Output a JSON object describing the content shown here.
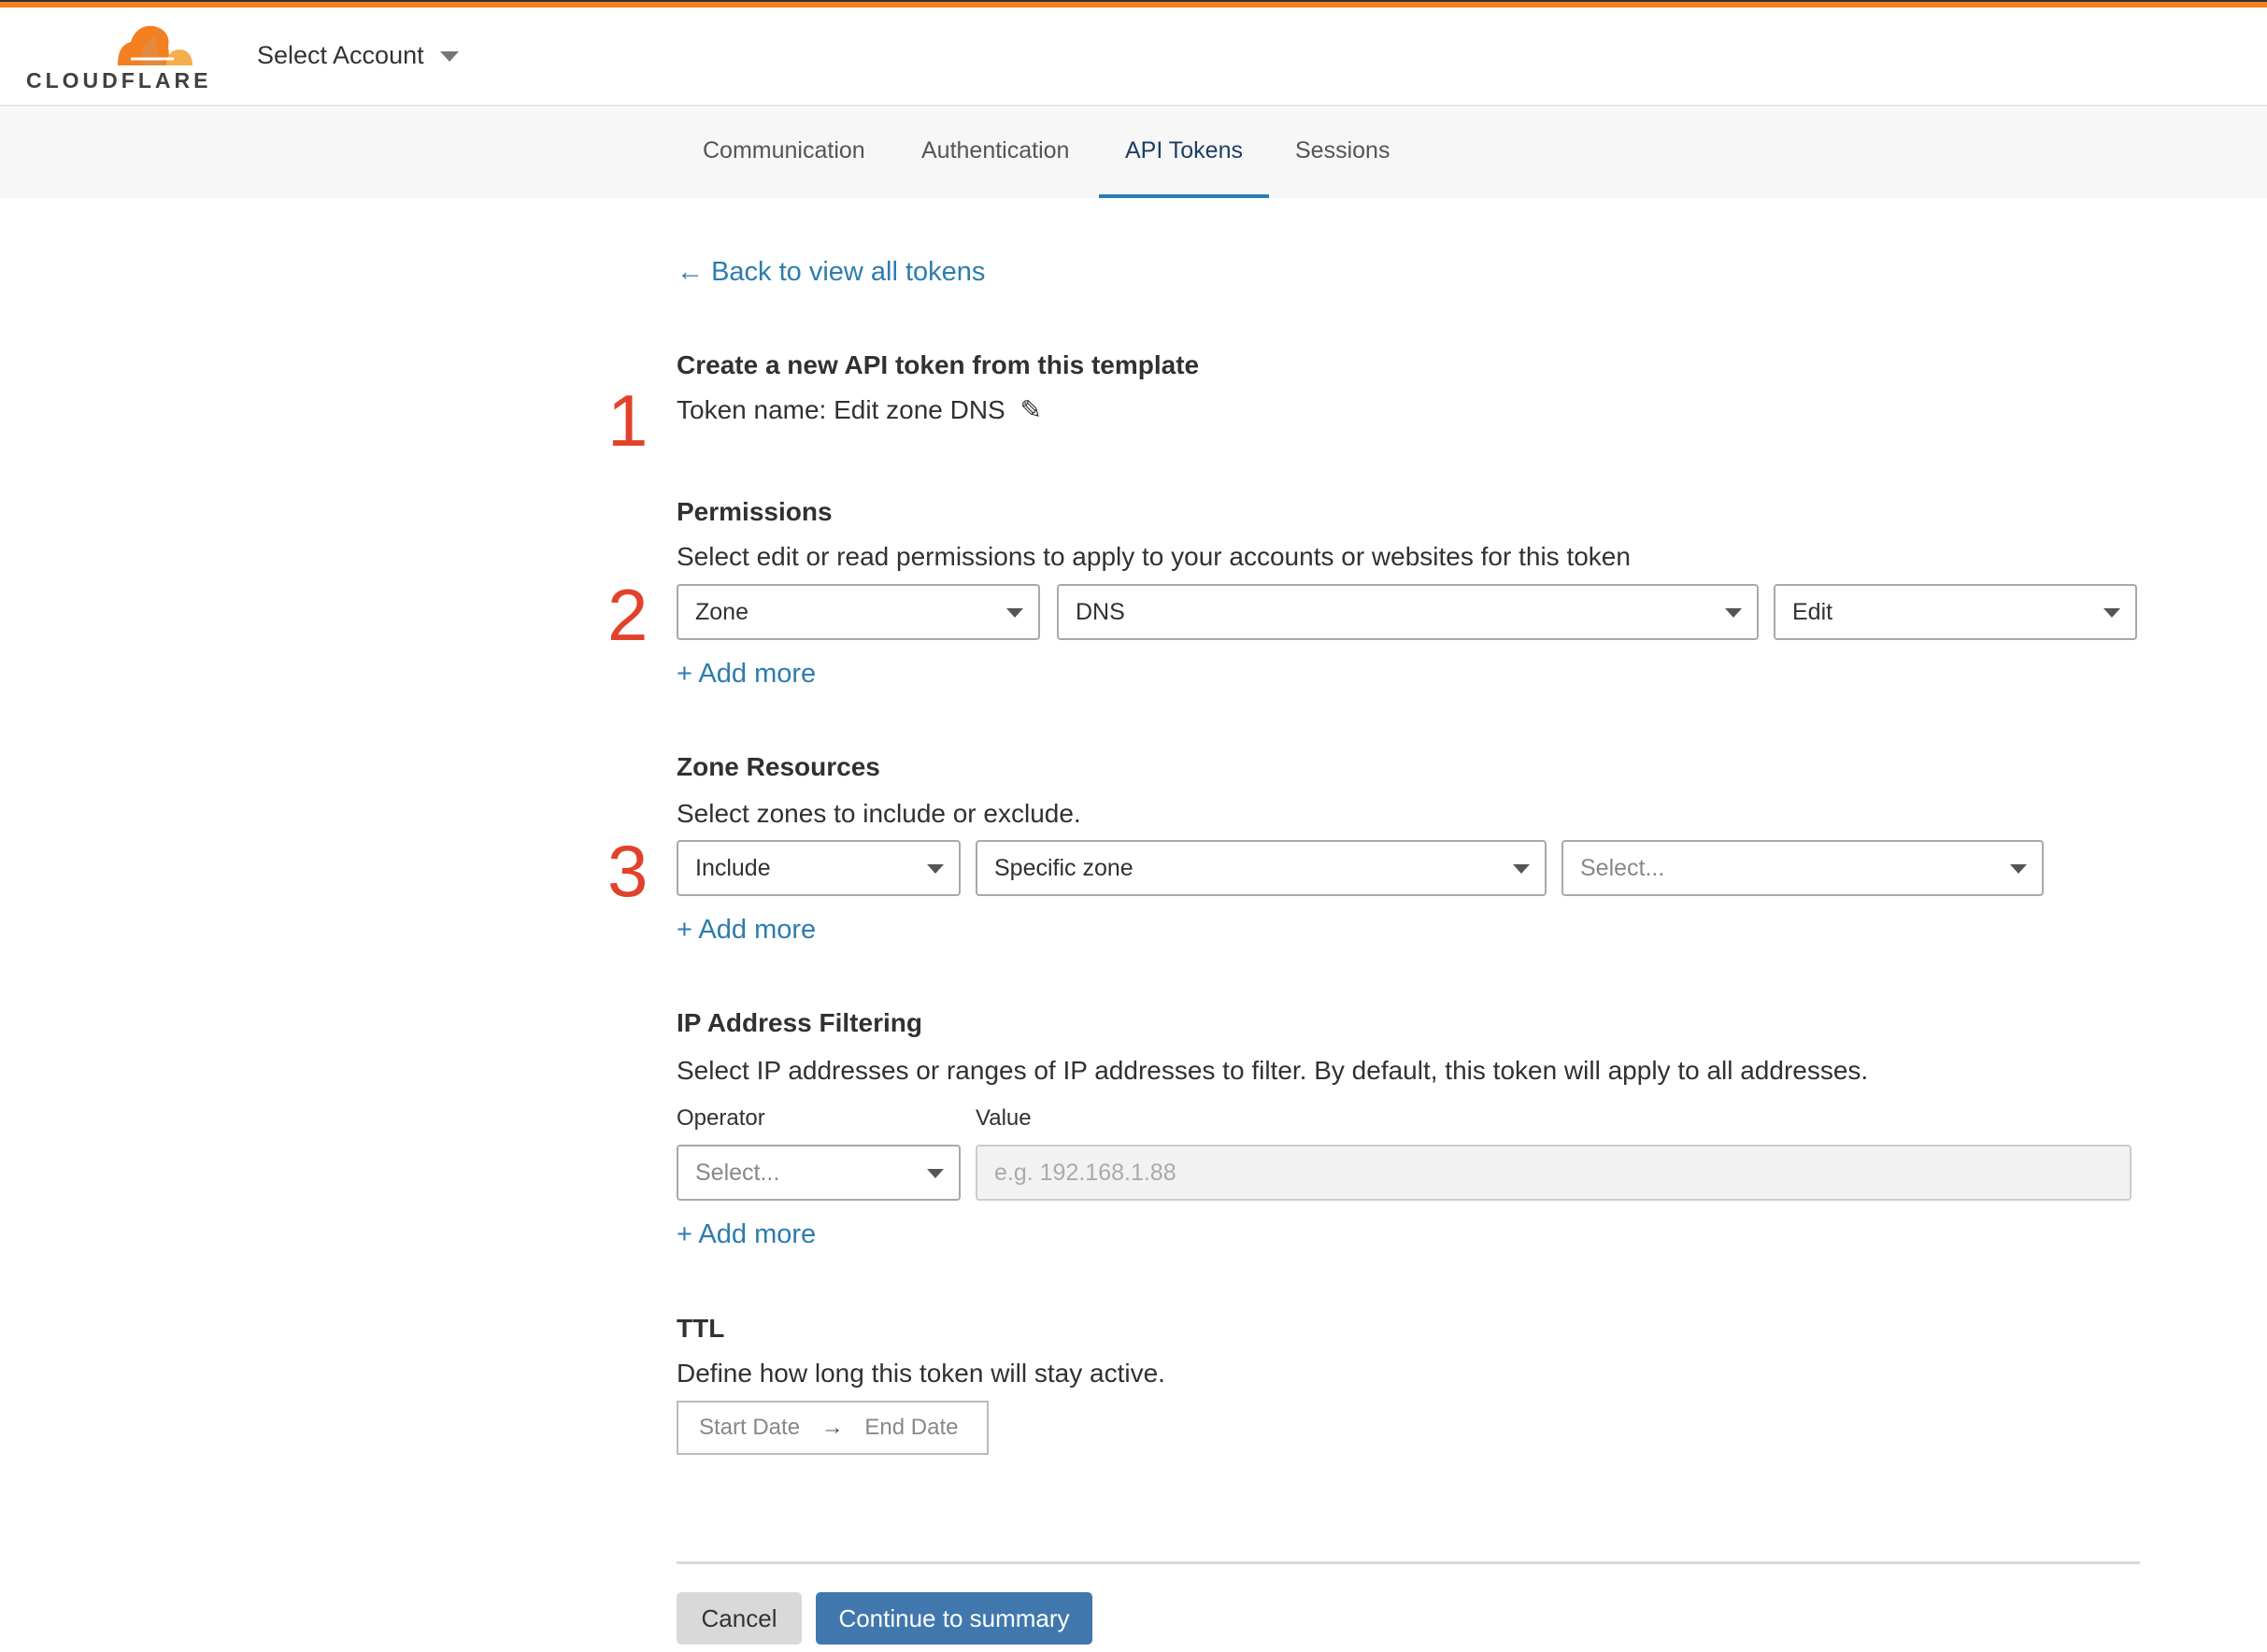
{
  "header": {
    "logo_text": "CLOUDFLARE",
    "account_selector": "Select Account"
  },
  "nav": {
    "tabs": [
      {
        "label": "Communication"
      },
      {
        "label": "Authentication"
      },
      {
        "label": "API Tokens",
        "active": true
      },
      {
        "label": "Sessions"
      }
    ]
  },
  "back_link": "Back to view all tokens",
  "steps": [
    "1",
    "2",
    "3"
  ],
  "template": {
    "heading": "Create a new API token from this template",
    "token_name": "Token name: Edit zone DNS"
  },
  "permissions": {
    "heading": "Permissions",
    "description": "Select edit or read permissions to apply to your accounts or websites for this token",
    "selects": [
      "Zone",
      "DNS",
      "Edit"
    ],
    "add_more": "Add more"
  },
  "zone_resources": {
    "heading": "Zone Resources",
    "description": "Select zones to include or exclude.",
    "selects": [
      "Include",
      "Specific zone"
    ],
    "zone_placeholder": "Select...",
    "add_more": "Add more"
  },
  "ip_filtering": {
    "heading": "IP Address Filtering",
    "description": "Select IP addresses or ranges of IP addresses to filter. By default, this token will apply to all addresses.",
    "operator_label": "Operator",
    "value_label": "Value",
    "operator_placeholder": "Select...",
    "value_placeholder": "e.g. 192.168.1.88",
    "add_more": "Add more"
  },
  "ttl": {
    "heading": "TTL",
    "description": "Define how long this token will stay active.",
    "start_placeholder": "Start Date",
    "end_placeholder": "End Date"
  },
  "actions": {
    "cancel": "Cancel",
    "continue": "Continue to summary"
  },
  "colors": {
    "brand_orange": "#f38020",
    "link_blue": "#2c7cb0",
    "primary_button": "#4078ad",
    "step_number": "#e2422b"
  }
}
